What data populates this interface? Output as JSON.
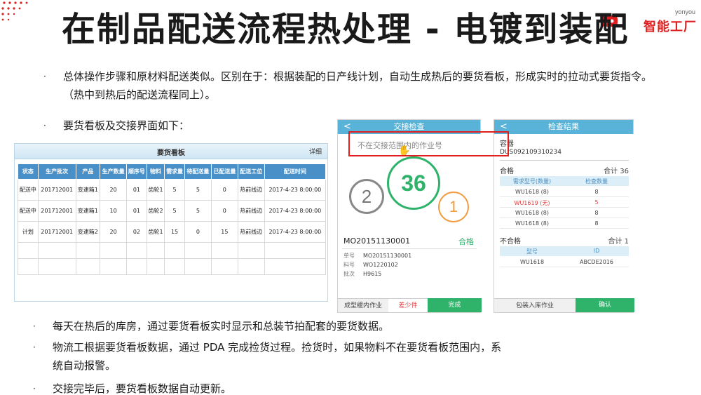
{
  "brand": {
    "small": "yonyou",
    "name": "智能工厂"
  },
  "slide": {
    "title": "在制品配送流程热处理 - 电镀到装配",
    "bullets": [
      "总体操作步骤和原材料配送类似。区别在于：根据装配的日产线计划，自动生成热后的要货看板，形成实时的拉动式要货指令。（热中到热后的配送流程同上）。",
      "要货看板及交接界面如下：",
      "每天在热后的库房，通过要货看板实时显示和总装节拍配套的要货数据。",
      "物流工根据要货看板数据，通过 PDA 完成捡货过程。捡货时，如果物料不在要货看板范围内，系统自动报警。",
      "交接完毕后，要货看板数据自动更新。"
    ]
  },
  "kanban": {
    "title": "要货看板",
    "link": "详细",
    "columns": [
      "状态",
      "生产批次",
      "产品",
      "生产数量",
      "顺序号",
      "物料",
      "需求量",
      "待配送量",
      "已配送量",
      "配送工位",
      "配送时间"
    ],
    "rows": [
      [
        "配送中",
        "201712001",
        "变速箱1",
        "20",
        "01",
        "齿轮1",
        "5",
        "5",
        "0",
        "热前线边",
        "2017-4-23 8:00:00"
      ],
      [
        "配送中",
        "201712001",
        "变速箱1",
        "10",
        "01",
        "齿轮2",
        "5",
        "5",
        "0",
        "热前线边",
        "2017-4-23 8:00:00"
      ],
      [
        "计划",
        "201712001",
        "变速箱2",
        "20",
        "02",
        "齿轮1",
        "15",
        "0",
        "15",
        "热前线边",
        "2017-4-23 8:00:00"
      ]
    ]
  },
  "phone1": {
    "title": "交接检查",
    "back": "<",
    "hint": "不在交接范围内的作业号",
    "center_count": "36",
    "left_count": "2",
    "right_count": "1",
    "mo_code": "MO20151130001",
    "mo_status": "合格",
    "fields": [
      {
        "k": "单号",
        "v": "MO20151130001"
      },
      {
        "k": "料号",
        "v": "WO1220102"
      },
      {
        "k": "批次",
        "v": "H9615"
      }
    ],
    "footer": [
      "成型缓内作业",
      "差少件",
      "完成"
    ]
  },
  "phone2": {
    "title": "检查结果",
    "container_label": "容器",
    "container_code": "DUS092109310234",
    "pass_label": "合格",
    "pass_total": "合计 36",
    "pass_headers": [
      "需求型号(数量)",
      "检查数量"
    ],
    "pass_rows": [
      {
        "a": "WU1618 (8)",
        "b": "8",
        "warn": false
      },
      {
        "a": "WU1619 (无)",
        "b": "5",
        "warn": true
      },
      {
        "a": "WU1618 (8)",
        "b": "8",
        "warn": false
      },
      {
        "a": "WU1618 (8)",
        "b": "8",
        "warn": false
      }
    ],
    "fail_label": "不合格",
    "fail_total": "合计 1",
    "fail_headers": [
      "型号",
      "ID"
    ],
    "fail_rows": [
      {
        "a": "WU1618",
        "b": "ABCDE2016"
      }
    ],
    "footer": [
      "包装入库作业",
      "确认"
    ]
  },
  "colors": {
    "accent": "#59b3d9",
    "ok": "#2fb36b",
    "warn": "#f19a3e",
    "alert": "#e02020"
  }
}
